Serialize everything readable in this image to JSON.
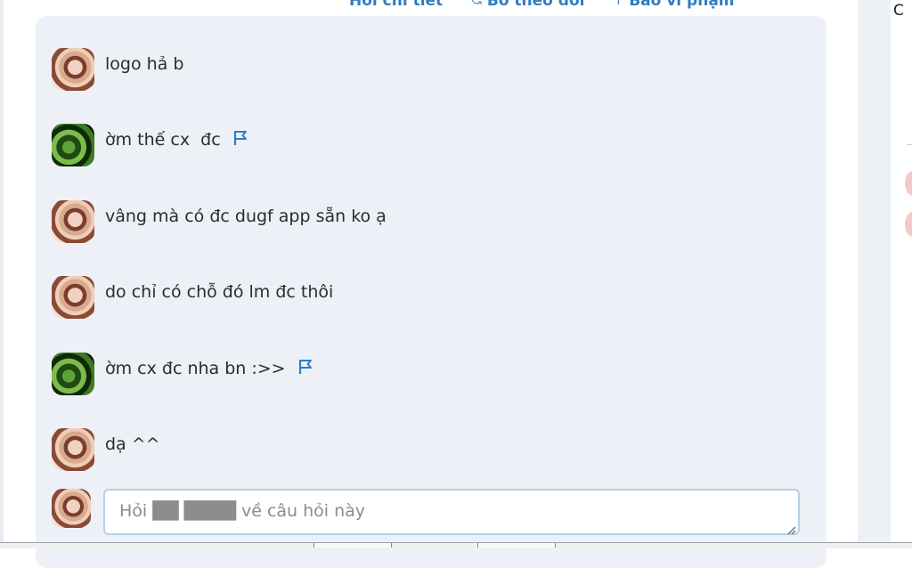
{
  "actions": [
    {
      "label": "Hỏi chi tiết",
      "icon": "question-icon"
    },
    {
      "label": "Bỏ theo dõi",
      "icon": "unfollow-icon"
    },
    {
      "label": "Báo vi phạm",
      "icon": "report-icon"
    }
  ],
  "comments": [
    {
      "text": "logo hả b",
      "avatar": "avatar-girl",
      "flag": false
    },
    {
      "text": "ờm thế cx  đc",
      "avatar": "avatar-leaves",
      "flag": true
    },
    {
      "text": "vâng mà có đc dugf app sẵn ko ạ",
      "avatar": "avatar-girl",
      "flag": false
    },
    {
      "text": "do chỉ có chỗ đó lm đc thôi",
      "avatar": "avatar-girl",
      "flag": false
    },
    {
      "text": "ờm cx đc nha bn :>>",
      "avatar": "avatar-leaves",
      "flag": true
    },
    {
      "text": "dạ ^^",
      "avatar": "avatar-girl",
      "flag": false
    }
  ],
  "reply": {
    "placeholder": "Hỏi ██ ████ về câu hỏi này",
    "value": ""
  },
  "right_panel": {
    "top_glyph": "C"
  },
  "colors": {
    "accent": "#2f7cc4",
    "flag": "#2f7cc4",
    "box_bg": "#edf1f7",
    "input_border": "#aed3e6"
  }
}
